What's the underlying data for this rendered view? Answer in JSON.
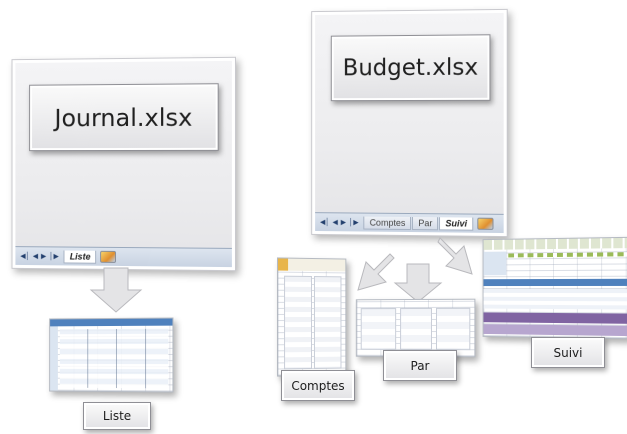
{
  "journal": {
    "file_name": "Journal.xlsx",
    "sheet_tabs": [
      "Liste"
    ],
    "active_tab": "Liste"
  },
  "budget": {
    "file_name": "Budget.xlsx",
    "sheet_tabs": [
      "Comptes",
      "Par",
      "Suivi"
    ],
    "active_tab": "Suivi"
  },
  "captions": {
    "liste": "Liste",
    "comptes": "Comptes",
    "par": "Par",
    "suivi": "Suivi"
  },
  "icons": {
    "nav": "sheet-nav-arrows-icon",
    "add_sheet": "insert-sheet-icon",
    "arrow": "down-arrow-icon"
  },
  "colors": {
    "arrow_fill": "#e4e4e6",
    "tabbar": "#c8d3e2",
    "thumb_header_blue": "#4f81bd",
    "thumb_accent_gold": "#e8b54a",
    "thumb_accent_purple": "#8064a2",
    "thumb_accent_green": "#9bbb59"
  }
}
